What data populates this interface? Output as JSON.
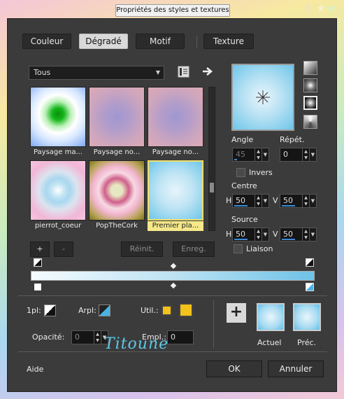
{
  "window": {
    "title": "Propriétés des styles et textures"
  },
  "tabs": [
    {
      "label": "Couleur"
    },
    {
      "label": "Dégradé",
      "active": true
    },
    {
      "label": "Motif"
    },
    {
      "label": "Texture"
    }
  ],
  "category_dropdown": {
    "value": "Tous"
  },
  "gradients": [
    {
      "label": "Paysage ma...",
      "colors": [
        "#0aa10f",
        "#b9f0b6",
        "#ffffff",
        "#7fa9f5"
      ]
    },
    {
      "label": "Paysage no...",
      "colors": [
        "#a59bd0",
        "#c9a2c2",
        "#d8a8b6"
      ]
    },
    {
      "label": "Paysage no...",
      "colors": [
        "#a59bd0",
        "#c9a2c2",
        "#d8a8b6"
      ]
    },
    {
      "label": "pierrot_coeur",
      "colors": [
        "#ffffff",
        "#a9d7ef",
        "#f2b6d6"
      ]
    },
    {
      "label": "PopTheCork",
      "colors": [
        "#e7e8c1",
        "#cf5f8a",
        "#f2b6d0",
        "#7d7520"
      ]
    },
    {
      "label": "Premier pla...",
      "colors": [
        "#e6f4fb",
        "#6ec6ea"
      ],
      "selected": true
    }
  ],
  "grid_buttons": {
    "add": "+",
    "remove": "-",
    "reset": "Réinit.",
    "save": "Enreg."
  },
  "angle": {
    "label": "Angle",
    "value": "45"
  },
  "repeat": {
    "label": "Répét.",
    "value": "0"
  },
  "invert": {
    "label": "Invers",
    "checked": false
  },
  "center": {
    "label": "Centre",
    "h_label": "H",
    "h_value": "50",
    "v_label": "V",
    "v_value": "50"
  },
  "source": {
    "label": "Source",
    "h_label": "H",
    "h_value": "50",
    "v_label": "V",
    "v_value": "50"
  },
  "link": {
    "label": "Liaison",
    "checked": false
  },
  "stops": {
    "opacity_label": "1pl:",
    "arrow_label": "Arpl:",
    "util_label": "Util.:",
    "opacity_field_label": "Opacité:",
    "opacity_value": "0",
    "empl_label": "Empl.:",
    "empl_value": "0",
    "swatch_color": "#f2c21a"
  },
  "preview_labels": {
    "current": "Actuel",
    "previous": "Préc."
  },
  "footer": {
    "help": "Aide",
    "signature": "Titoune",
    "ok": "OK",
    "cancel": "Annuler"
  }
}
